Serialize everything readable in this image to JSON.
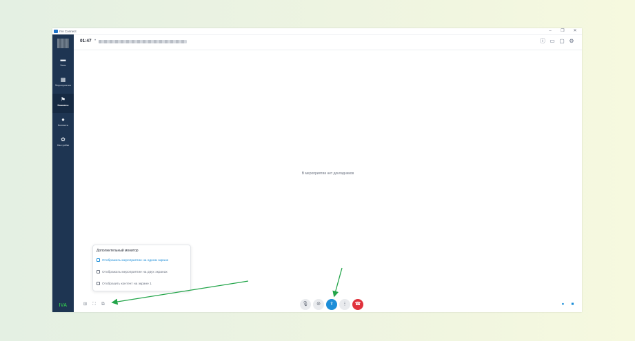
{
  "window": {
    "title": "IVA Connect",
    "controls": {
      "minimize": "–",
      "maximize": "❐",
      "close": "✕"
    }
  },
  "sidebar": {
    "items": [
      {
        "label": "Чаты",
        "icon": "chat-icon",
        "glyph": "▬",
        "active": false
      },
      {
        "label": "Мероприятия",
        "icon": "calendar-icon",
        "glyph": "▦",
        "active": false
      },
      {
        "label": "Комнаты",
        "icon": "room-icon",
        "glyph": "⚑",
        "active": true
      },
      {
        "label": "Контакты",
        "icon": "contacts-icon",
        "glyph": "●",
        "active": false
      },
      {
        "label": "Настройки",
        "icon": "gear-icon",
        "glyph": "✿",
        "active": false
      }
    ],
    "brand": "IVA"
  },
  "header": {
    "timer": "01:47",
    "separator": "•",
    "icons": [
      {
        "name": "info-icon",
        "glyph": "ⓘ"
      },
      {
        "name": "folder-icon",
        "glyph": "▭"
      },
      {
        "name": "chat-icon",
        "glyph": "▢"
      },
      {
        "name": "settings-icon",
        "glyph": "⚙"
      }
    ]
  },
  "main": {
    "empty_message": "В мероприятии нет докладчиков"
  },
  "monitor_popup": {
    "title": "Дополнительный монитор",
    "options": [
      {
        "label": "Отображать мероприятие на одном экране",
        "selected": true
      },
      {
        "label": "Отображать мероприятие на двух экранах",
        "selected": false
      },
      {
        "label": "Отобразить контент на экране 1",
        "selected": false
      }
    ]
  },
  "bottom_bar": {
    "left_icons": [
      {
        "name": "grid-layout-icon",
        "glyph": "⊞"
      },
      {
        "name": "fullscreen-icon",
        "glyph": "⛶"
      },
      {
        "name": "second-monitor-icon",
        "glyph": "⧉"
      }
    ],
    "controls": [
      {
        "name": "microphone-icon",
        "glyph": "🎙",
        "kind": "default"
      },
      {
        "name": "camera-off-icon",
        "glyph": "⊘",
        "kind": "default"
      },
      {
        "name": "share-screen-icon",
        "glyph": "⇪",
        "kind": "share"
      },
      {
        "name": "more-icon",
        "glyph": "⋮",
        "kind": "default"
      },
      {
        "name": "hang-up-icon",
        "glyph": "☎",
        "kind": "hangup"
      }
    ],
    "right_icons": [
      {
        "name": "participants-icon",
        "glyph": "●"
      },
      {
        "name": "chat-bubble-icon",
        "glyph": "■"
      }
    ]
  },
  "colors": {
    "sidebar": "#1e3552",
    "accent": "#1d8ed8",
    "hangup": "#e0323c",
    "arrow": "#23a54a"
  }
}
